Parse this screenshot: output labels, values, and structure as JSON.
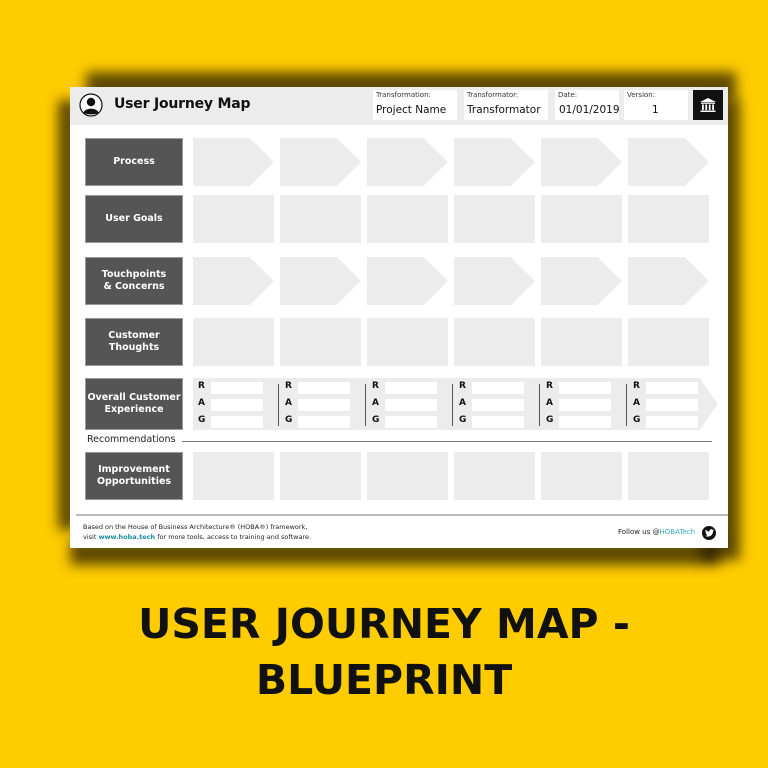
{
  "header": {
    "title": "User Journey Map",
    "fields": [
      {
        "label": "Transformation:",
        "value": "Project Name"
      },
      {
        "label": "Transformator:",
        "value": "Transformator"
      },
      {
        "label": "Date:",
        "value": "01/01/2019"
      },
      {
        "label": "Version:",
        "value": "1"
      }
    ],
    "logo_icon": "bank-building-icon",
    "avatar_icon": "user-avatar-icon"
  },
  "rows": [
    {
      "label": "Process",
      "style": "arrow"
    },
    {
      "label": "User Goals",
      "style": "box"
    },
    {
      "label": "Touchpoints\n& Concerns",
      "style": "arrow"
    },
    {
      "label": "Customer\nThoughts",
      "style": "box"
    },
    {
      "label": "Overall Customer\nExperience",
      "style": "rag"
    },
    {
      "label": "Improvement\nOpportunities",
      "style": "box"
    }
  ],
  "rag_letters": [
    "R",
    "A",
    "G"
  ],
  "columns": 6,
  "recommendations_label": "Recommendations",
  "footer": {
    "line1": "Based on the House of Business Architecture® (HOBA®) framework,",
    "line2_prefix": "visit ",
    "link": "www.hoba.tech",
    "line2_suffix": " for more tools, access to training and software.",
    "follow_prefix": "Follow us @",
    "handle": "HOBATech",
    "social_icon": "twitter-icon"
  },
  "big_title_line1": "USER JOURNEY MAP -",
  "big_title_line2": "BLUEPRINT",
  "colors": {
    "background": "#FFCC00",
    "label_box": "#555555",
    "cell": "#ECECEC",
    "link": "#1A8FA0"
  }
}
